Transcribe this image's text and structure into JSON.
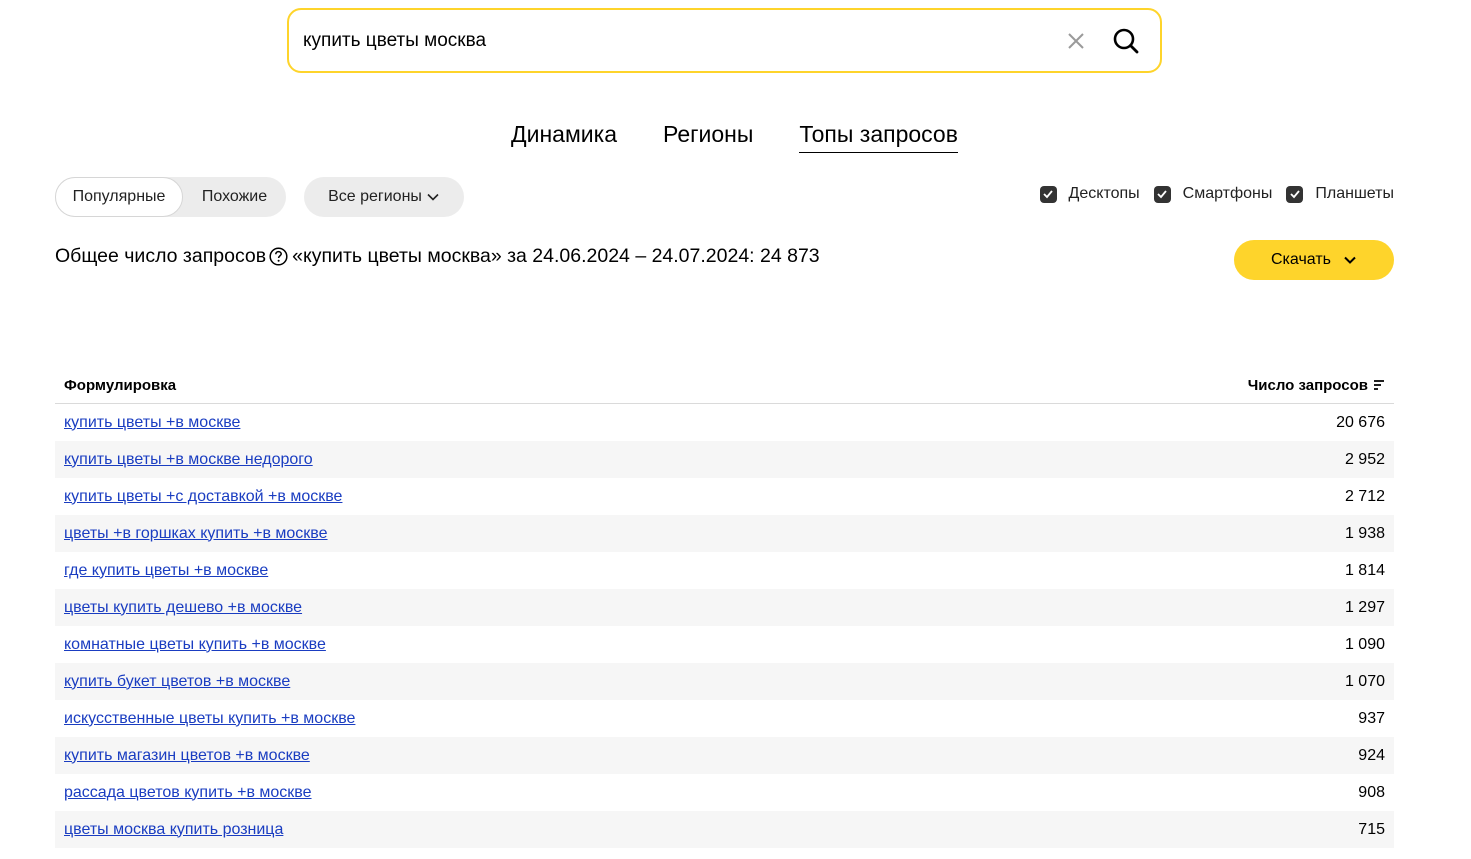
{
  "search": {
    "value": "купить цветы москва",
    "clear_icon": "close-icon",
    "search_icon": "search-icon"
  },
  "tabs": [
    {
      "label": "Динамика",
      "active": false
    },
    {
      "label": "Регионы",
      "active": false
    },
    {
      "label": "Топы запросов",
      "active": true
    }
  ],
  "filters": {
    "mode_popular": "Популярные",
    "mode_similar": "Похожие",
    "region": "Все регионы",
    "devices": [
      {
        "label": "Десктопы",
        "checked": true
      },
      {
        "label": "Смартфоны",
        "checked": true
      },
      {
        "label": "Планшеты",
        "checked": true
      }
    ]
  },
  "summary": {
    "prefix": "Общее число запросов",
    "text": "«купить цветы москва» за 24.06.2024 – 24.07.2024: 24 873"
  },
  "download_label": "Скачать",
  "table": {
    "col_phrase": "Формулировка",
    "col_count": "Число запросов",
    "rows": [
      {
        "phrase": "купить цветы +в москве",
        "count": "20 676"
      },
      {
        "phrase": "купить цветы +в москве недорого",
        "count": "2 952"
      },
      {
        "phrase": "купить цветы +с доставкой +в москве",
        "count": "2 712"
      },
      {
        "phrase": "цветы +в горшках купить +в москве",
        "count": "1 938"
      },
      {
        "phrase": "где купить цветы +в москве",
        "count": "1 814"
      },
      {
        "phrase": "цветы купить дешево +в москве",
        "count": "1 297"
      },
      {
        "phrase": "комнатные цветы купить +в москве",
        "count": "1 090"
      },
      {
        "phrase": "купить букет цветов +в москве",
        "count": "1 070"
      },
      {
        "phrase": "искусственные цветы купить +в москве",
        "count": "937"
      },
      {
        "phrase": "купить магазин цветов +в москве",
        "count": "924"
      },
      {
        "phrase": "рассада цветов купить +в москве",
        "count": "908"
      },
      {
        "phrase": "цветы москва купить розница",
        "count": "715"
      }
    ]
  },
  "colors": {
    "accent": "#fed42b",
    "link": "#1a3dc1"
  }
}
